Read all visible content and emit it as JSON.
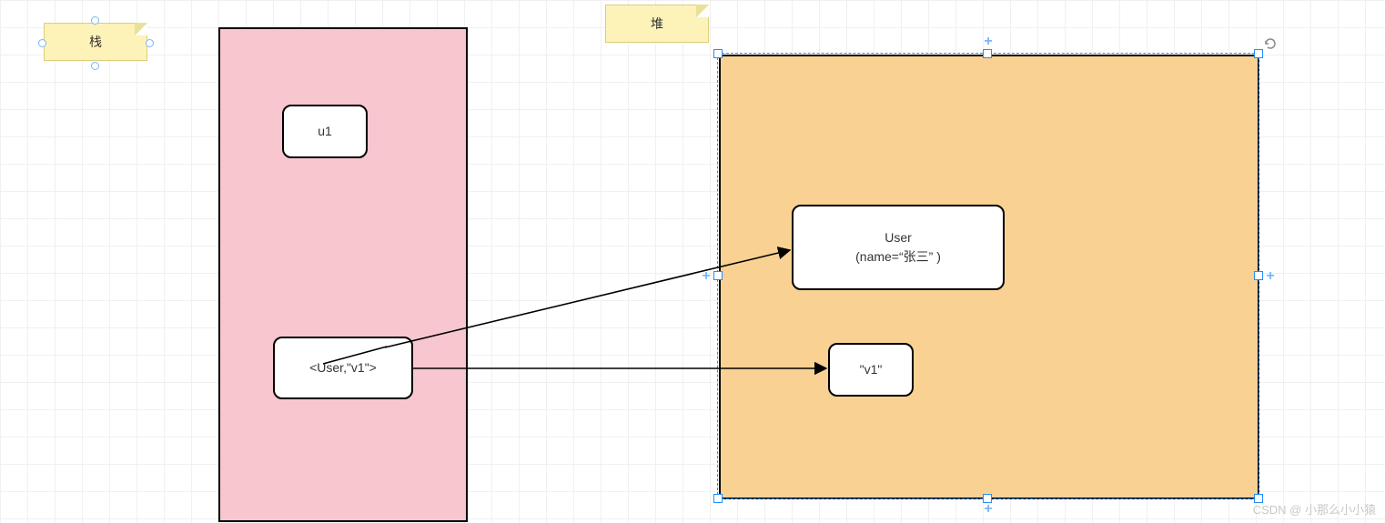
{
  "notes": {
    "stack": "栈",
    "heap": "堆"
  },
  "nodes": {
    "u1": "u1",
    "userv1": "<User,\"v1\">",
    "user_line1": "User",
    "user_line2": "(name=“张三” )",
    "v1": "\"v1\""
  },
  "colors": {
    "stack_bg": "#f7c6cf",
    "heap_bg": "#f8d193",
    "note_bg": "#fdf2b7",
    "selection": "#1e90ff"
  },
  "watermark": "CSDN @ 小那么小小猿"
}
